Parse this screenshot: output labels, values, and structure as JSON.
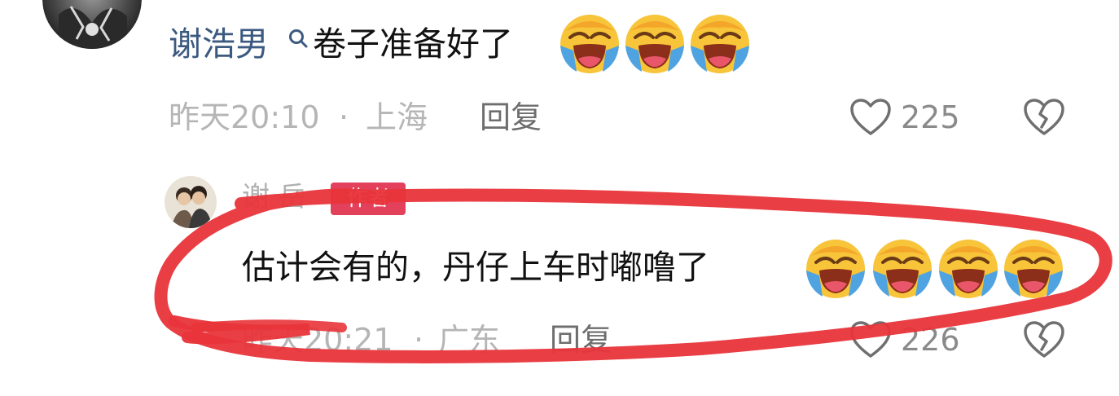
{
  "comment1": {
    "username": "谢浩男",
    "text": "卷子准备好了",
    "time": "昨天20:10",
    "separator": "·",
    "location": "上海",
    "reply_label": "回复",
    "like_count": "225",
    "emojis": [
      "laugh-cry-emoji",
      "laugh-cry-emoji",
      "laugh-cry-emoji"
    ]
  },
  "comment2": {
    "username": "谢 岳",
    "badge": "作者",
    "text": "估计会有的，丹仔上车时嘟噜了",
    "time": "昨天20:21",
    "separator": "·",
    "location": "广东",
    "reply_label": "回复",
    "like_count": "226",
    "emojis": [
      "laugh-cry-emoji",
      "laugh-cry-emoji",
      "laugh-cry-emoji",
      "laugh-cry-emoji"
    ]
  },
  "colors": {
    "username": "#3c5a80",
    "badge_bg": "#e2405b",
    "meta_text": "#b5b5b5",
    "scribble": "#e8343a"
  }
}
